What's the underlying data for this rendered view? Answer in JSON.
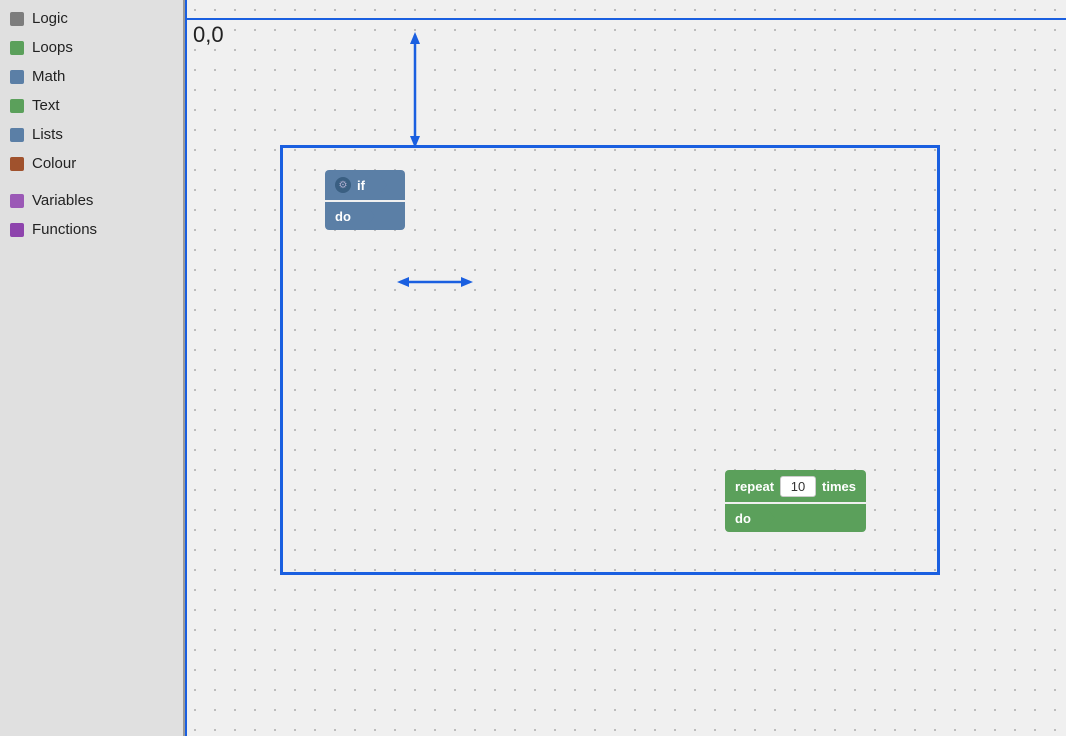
{
  "sidebar": {
    "items": [
      {
        "id": "logic",
        "label": "Logic",
        "color": "#7d7d7d"
      },
      {
        "id": "loops",
        "label": "Loops",
        "color": "#5ba05b"
      },
      {
        "id": "math",
        "label": "Math",
        "color": "#5b7fa6"
      },
      {
        "id": "text",
        "label": "Text",
        "color": "#5ba05b"
      },
      {
        "id": "lists",
        "label": "Lists",
        "color": "#5b7fa6"
      },
      {
        "id": "colour",
        "label": "Colour",
        "color": "#a0522d"
      },
      {
        "id": "variables",
        "label": "Variables",
        "color": "#9b59b6"
      },
      {
        "id": "functions",
        "label": "Functions",
        "color": "#8e44ad"
      }
    ]
  },
  "workspace": {
    "origin_label": "0,0",
    "if_block": {
      "top_label": "if",
      "bottom_label": "do"
    },
    "repeat_block": {
      "repeat_label": "repeat",
      "times_label": "times",
      "input_value": "10",
      "do_label": "do"
    }
  }
}
